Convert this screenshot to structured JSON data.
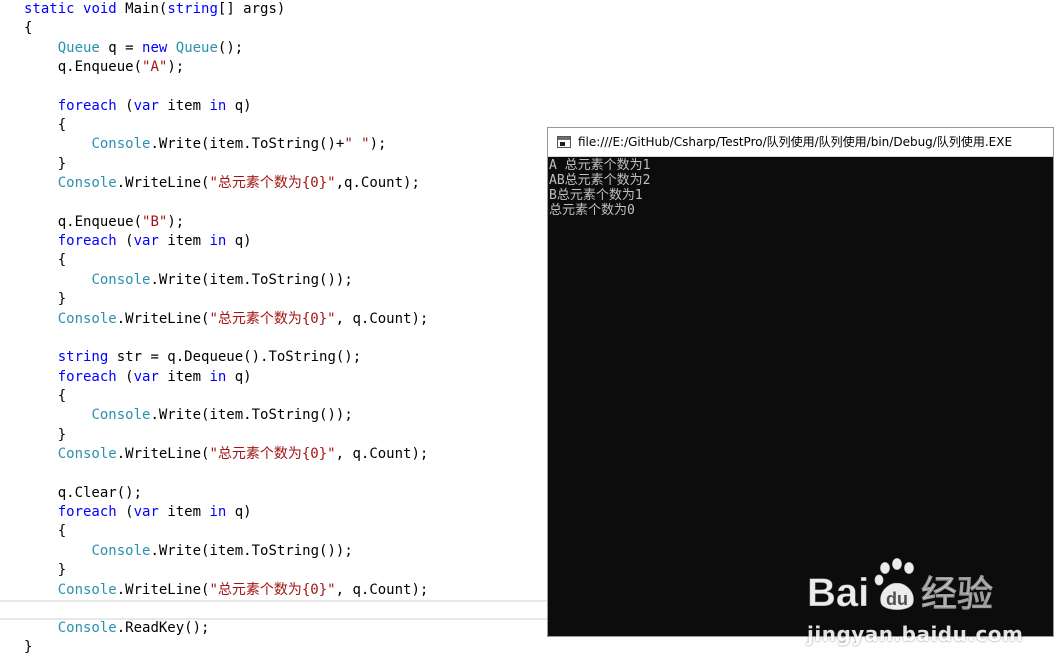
{
  "editor": {
    "lines": [
      [
        [
          "kw",
          "static"
        ],
        [
          "pl",
          " "
        ],
        [
          "kw",
          "void"
        ],
        [
          "pl",
          " Main("
        ],
        [
          "kw",
          "string"
        ],
        [
          "pl",
          "[] args)"
        ]
      ],
      [
        [
          "pl",
          "{"
        ]
      ],
      [
        [
          "pl",
          "    "
        ],
        [
          "ty",
          "Queue"
        ],
        [
          "pl",
          " q = "
        ],
        [
          "kw",
          "new"
        ],
        [
          "pl",
          " "
        ],
        [
          "ty",
          "Queue"
        ],
        [
          "pl",
          "();"
        ]
      ],
      [
        [
          "pl",
          "    q.Enqueue("
        ],
        [
          "st",
          "\"A\""
        ],
        [
          "pl",
          ");"
        ]
      ],
      [],
      [
        [
          "pl",
          "    "
        ],
        [
          "kw",
          "foreach"
        ],
        [
          "pl",
          " ("
        ],
        [
          "kw",
          "var"
        ],
        [
          "pl",
          " item "
        ],
        [
          "kw",
          "in"
        ],
        [
          "pl",
          " q)"
        ]
      ],
      [
        [
          "pl",
          "    {"
        ]
      ],
      [
        [
          "pl",
          "        "
        ],
        [
          "ty",
          "Console"
        ],
        [
          "pl",
          ".Write(item.ToString()+"
        ],
        [
          "st",
          "\" \""
        ],
        [
          "pl",
          ");"
        ]
      ],
      [
        [
          "pl",
          "    }"
        ]
      ],
      [
        [
          "pl",
          "    "
        ],
        [
          "ty",
          "Console"
        ],
        [
          "pl",
          ".WriteLine("
        ],
        [
          "st",
          "\"总元素个数为{0}\""
        ],
        [
          "pl",
          ",q.Count);"
        ]
      ],
      [],
      [
        [
          "pl",
          "    q.Enqueue("
        ],
        [
          "st",
          "\"B\""
        ],
        [
          "pl",
          ");"
        ]
      ],
      [
        [
          "pl",
          "    "
        ],
        [
          "kw",
          "foreach"
        ],
        [
          "pl",
          " ("
        ],
        [
          "kw",
          "var"
        ],
        [
          "pl",
          " item "
        ],
        [
          "kw",
          "in"
        ],
        [
          "pl",
          " q)"
        ]
      ],
      [
        [
          "pl",
          "    {"
        ]
      ],
      [
        [
          "pl",
          "        "
        ],
        [
          "ty",
          "Console"
        ],
        [
          "pl",
          ".Write(item.ToString());"
        ]
      ],
      [
        [
          "pl",
          "    }"
        ]
      ],
      [
        [
          "pl",
          "    "
        ],
        [
          "ty",
          "Console"
        ],
        [
          "pl",
          ".WriteLine("
        ],
        [
          "st",
          "\"总元素个数为{0}\""
        ],
        [
          "pl",
          ", q.Count);"
        ]
      ],
      [],
      [
        [
          "pl",
          "    "
        ],
        [
          "kw",
          "string"
        ],
        [
          "pl",
          " str = q.Dequeue().ToString();"
        ]
      ],
      [
        [
          "pl",
          "    "
        ],
        [
          "kw",
          "foreach"
        ],
        [
          "pl",
          " ("
        ],
        [
          "kw",
          "var"
        ],
        [
          "pl",
          " item "
        ],
        [
          "kw",
          "in"
        ],
        [
          "pl",
          " q)"
        ]
      ],
      [
        [
          "pl",
          "    {"
        ]
      ],
      [
        [
          "pl",
          "        "
        ],
        [
          "ty",
          "Console"
        ],
        [
          "pl",
          ".Write(item.ToString());"
        ]
      ],
      [
        [
          "pl",
          "    }"
        ]
      ],
      [
        [
          "pl",
          "    "
        ],
        [
          "ty",
          "Console"
        ],
        [
          "pl",
          ".WriteLine("
        ],
        [
          "st",
          "\"总元素个数为{0}\""
        ],
        [
          "pl",
          ", q.Count);"
        ]
      ],
      [],
      [
        [
          "pl",
          "    q.Clear();"
        ]
      ],
      [
        [
          "pl",
          "    "
        ],
        [
          "kw",
          "foreach"
        ],
        [
          "pl",
          " ("
        ],
        [
          "kw",
          "var"
        ],
        [
          "pl",
          " item "
        ],
        [
          "kw",
          "in"
        ],
        [
          "pl",
          " q)"
        ]
      ],
      [
        [
          "pl",
          "    {"
        ]
      ],
      [
        [
          "pl",
          "        "
        ],
        [
          "ty",
          "Console"
        ],
        [
          "pl",
          ".Write(item.ToString());"
        ]
      ],
      [
        [
          "pl",
          "    }"
        ]
      ],
      [
        [
          "pl",
          "    "
        ],
        [
          "ty",
          "Console"
        ],
        [
          "pl",
          ".WriteLine("
        ],
        [
          "st",
          "\"总元素个数为{0}\""
        ],
        [
          "pl",
          ", q.Count);"
        ]
      ],
      [],
      [
        [
          "pl",
          "    "
        ],
        [
          "ty",
          "Console"
        ],
        [
          "pl",
          ".ReadKey();"
        ]
      ],
      [
        [
          "pl",
          "}"
        ]
      ]
    ],
    "colors": {
      "keyword": "#0000ff",
      "type": "#2b91af",
      "string": "#a31515",
      "plain": "#000000"
    }
  },
  "console": {
    "title": "file:///E:/GitHub/Csharp/TestPro/队列使用/队列使用/bin/Debug/队列使用.EXE",
    "output": [
      "A 总元素个数为1",
      "AB总元素个数为2",
      "B总元素个数为1",
      "总元素个数为0"
    ],
    "background": "#0c0c0c",
    "foreground": "#c0c0c0"
  },
  "watermark": {
    "logo_text": "Bai du 经验",
    "url": "jingyan.baidu.com"
  }
}
